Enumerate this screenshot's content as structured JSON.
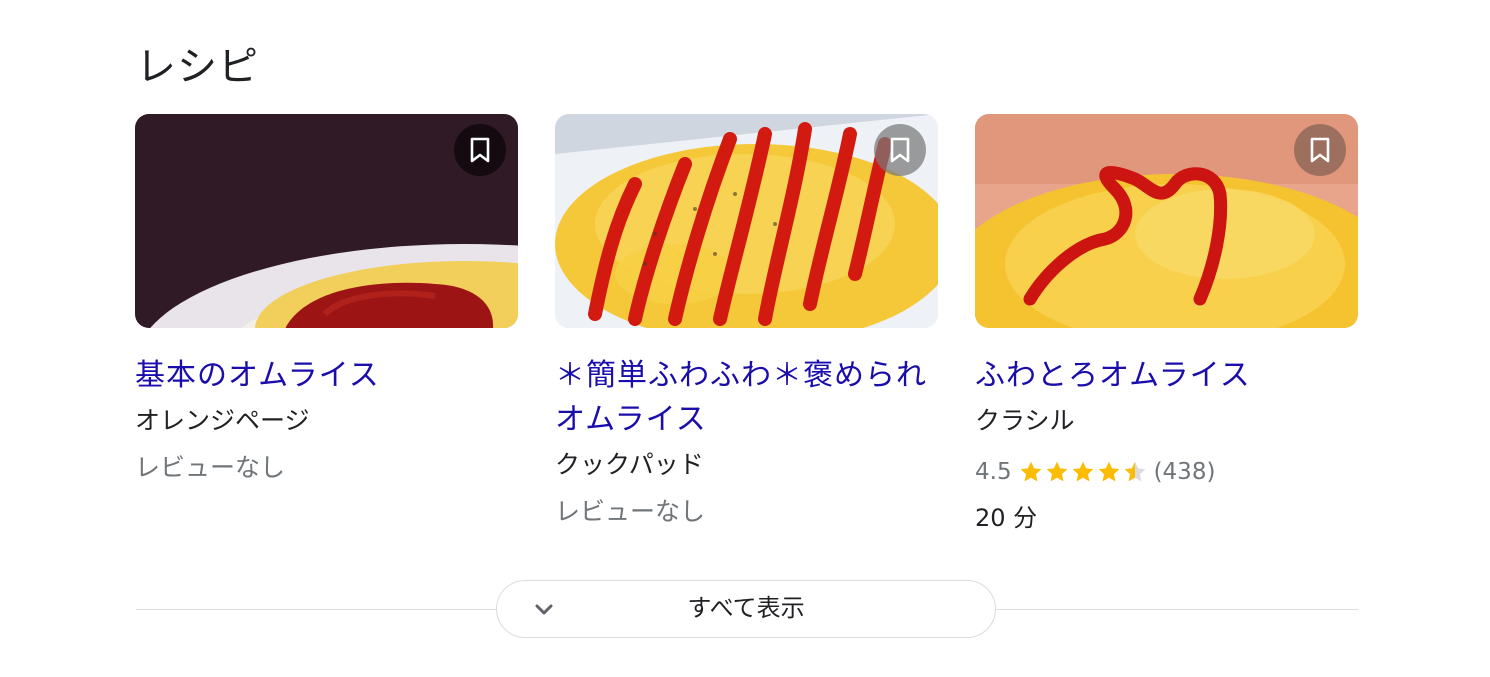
{
  "section": {
    "title": "レシピ"
  },
  "cards": [
    {
      "title": "基本のオムライス",
      "source": "オレンジページ",
      "review": "レビューなし"
    },
    {
      "title": "＊簡単ふわふわ＊褒められオムライス",
      "source": "クックパッド",
      "review": "レビューなし"
    },
    {
      "title": "ふわとろオムライス",
      "source": "クラシル",
      "rating": "4.5",
      "rating_fraction": 0.9,
      "review_count": "(438)",
      "time": "20 分"
    }
  ],
  "show_all": {
    "label": "すべて表示"
  },
  "icons": {
    "bookmark": "bookmark-icon",
    "star": "star-icon",
    "chevron": "chevron-down-icon"
  },
  "colors": {
    "link": "#1a0dab",
    "text": "#202124",
    "muted": "#70757a",
    "star": "#fbbc04",
    "star_empty": "#dadce0",
    "divider": "#dadce0"
  }
}
